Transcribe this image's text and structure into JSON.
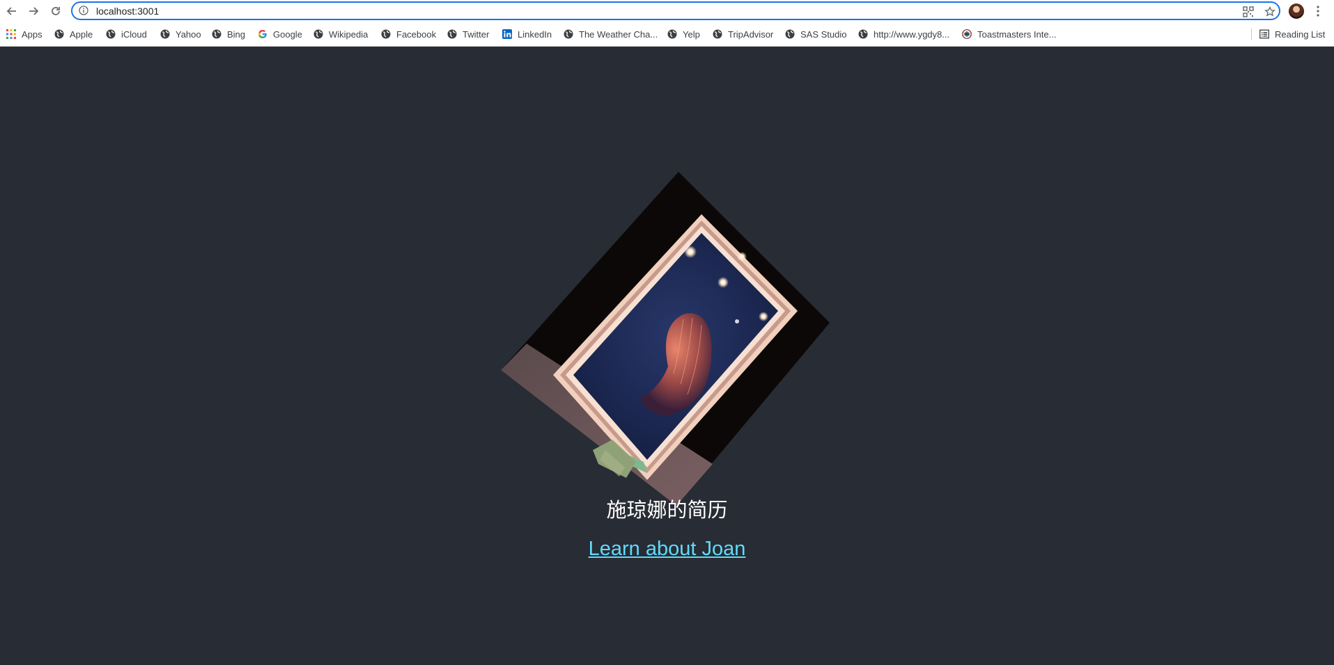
{
  "browser": {
    "url": "localhost:3001",
    "bookmarks": [
      {
        "label": "Apps",
        "icon": "apps-grid-icon"
      },
      {
        "label": "Apple",
        "icon": "globe-icon"
      },
      {
        "label": "iCloud",
        "icon": "globe-icon"
      },
      {
        "label": "Yahoo",
        "icon": "globe-icon"
      },
      {
        "label": "Bing",
        "icon": "globe-icon"
      },
      {
        "label": "Google",
        "icon": "google-icon"
      },
      {
        "label": "Wikipedia",
        "icon": "globe-icon"
      },
      {
        "label": "Facebook",
        "icon": "globe-icon"
      },
      {
        "label": "Twitter",
        "icon": "globe-icon"
      },
      {
        "label": "LinkedIn",
        "icon": "linkedin-icon"
      },
      {
        "label": "The Weather Cha...",
        "icon": "globe-icon"
      },
      {
        "label": "Yelp",
        "icon": "globe-icon"
      },
      {
        "label": "TripAdvisor",
        "icon": "globe-icon"
      },
      {
        "label": "SAS Studio",
        "icon": "globe-icon"
      },
      {
        "label": "http://www.ygdy8...",
        "icon": "globe-icon"
      },
      {
        "label": "Toastmasters Inte...",
        "icon": "toastmasters-icon"
      }
    ],
    "reading_list": "Reading List"
  },
  "app": {
    "background_color": "#282c34",
    "title": "施琼娜的简历",
    "link_text": "Learn about Joan",
    "link_color": "#61dafb"
  }
}
